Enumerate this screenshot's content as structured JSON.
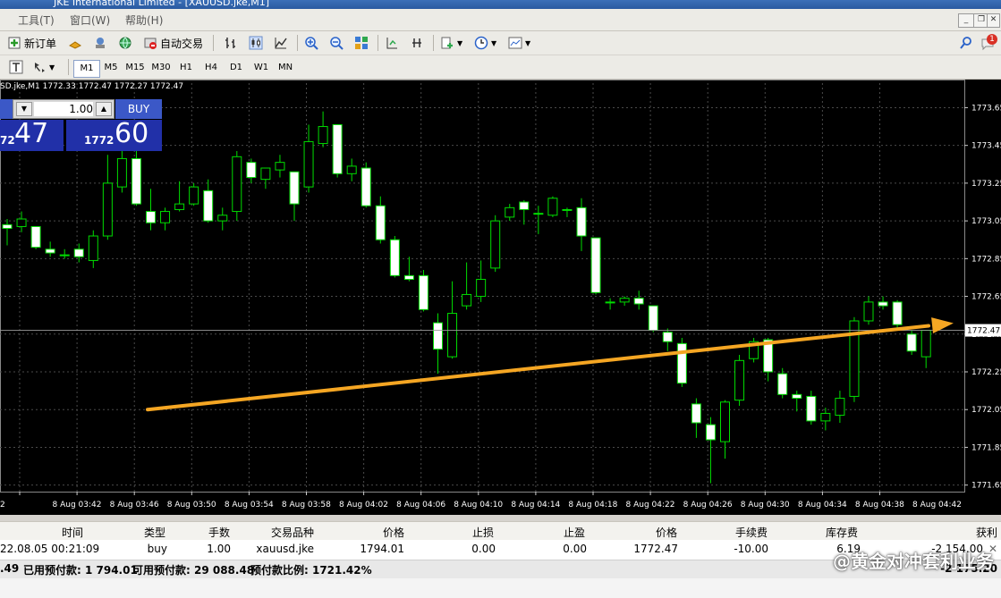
{
  "window": {
    "title_fragment": "JKE International Limited - [XAUUSD.jke,M1]",
    "menus": [
      "工具(T)",
      "窗口(W)",
      "帮助(H)"
    ]
  },
  "toolbar": {
    "new_order_label": "新订单",
    "auto_trade_label": "自动交易",
    "timeframes": [
      "M1",
      "M5",
      "M15",
      "M30",
      "H1",
      "H4",
      "D1",
      "W1",
      "MN"
    ],
    "active_timeframe": "M1",
    "notification_count": "1"
  },
  "chart": {
    "ohlc_label": "SD.jke,M1  1772.33  1772.47  1772.27  1772.47",
    "current_price_label": "1772.47",
    "price_ticks": [
      "1773.65",
      "1773.45",
      "1773.25",
      "1773.05",
      "1772.85",
      "1772.65",
      "1772.45",
      "1772.25",
      "1772.05",
      "1771.85",
      "1771.65"
    ],
    "time_ticks": [
      "8 Aug 03:42",
      "8 Aug 03:46",
      "8 Aug 03:50",
      "8 Aug 03:54",
      "8 Aug 03:58",
      "8 Aug 04:02",
      "8 Aug 04:06",
      "8 Aug 04:10",
      "8 Aug 04:14",
      "8 Aug 04:18",
      "8 Aug 04:22",
      "8 Aug 04:26",
      "8 Aug 04:30",
      "8 Aug 04:34",
      "8 Aug 04:38",
      "8 Aug 04:42"
    ],
    "first_time_tick_fragment": "2",
    "colors": {
      "background": "#000000",
      "candle": "#00dd00",
      "bull_body": "#000000",
      "bear_body": "#ffffff",
      "arrow": "#f5a623",
      "grid": "#4a4a4a"
    },
    "one_click": {
      "lot_value": "1.00",
      "buy_label": "BUY",
      "sell_price_small": "72",
      "sell_price_big": "47",
      "buy_price_small": "1772",
      "buy_price_big": "60"
    }
  },
  "chart_data": {
    "type": "candlestick",
    "y_range": [
      1771.62,
      1773.78
    ],
    "candles": [
      {
        "o": 1773.03,
        "h": 1773.06,
        "l": 1772.92,
        "c": 1773.01
      },
      {
        "o": 1773.02,
        "h": 1773.1,
        "l": 1772.99,
        "c": 1773.06
      },
      {
        "o": 1773.02,
        "h": 1773.02,
        "l": 1772.9,
        "c": 1772.91
      },
      {
        "o": 1772.9,
        "h": 1772.94,
        "l": 1772.86,
        "c": 1772.88
      },
      {
        "o": 1772.87,
        "h": 1772.9,
        "l": 1772.85,
        "c": 1772.87
      },
      {
        "o": 1772.9,
        "h": 1772.93,
        "l": 1772.83,
        "c": 1772.86
      },
      {
        "o": 1772.84,
        "h": 1773.0,
        "l": 1772.8,
        "c": 1772.97
      },
      {
        "o": 1772.97,
        "h": 1773.4,
        "l": 1772.95,
        "c": 1773.25
      },
      {
        "o": 1773.23,
        "h": 1773.42,
        "l": 1773.2,
        "c": 1773.38
      },
      {
        "o": 1773.38,
        "h": 1773.43,
        "l": 1773.13,
        "c": 1773.14
      },
      {
        "o": 1773.1,
        "h": 1773.22,
        "l": 1773.0,
        "c": 1773.04
      },
      {
        "o": 1773.04,
        "h": 1773.12,
        "l": 1773.0,
        "c": 1773.1
      },
      {
        "o": 1773.11,
        "h": 1773.26,
        "l": 1773.1,
        "c": 1773.14
      },
      {
        "o": 1773.14,
        "h": 1773.25,
        "l": 1773.13,
        "c": 1773.23
      },
      {
        "o": 1773.21,
        "h": 1773.27,
        "l": 1773.04,
        "c": 1773.05
      },
      {
        "o": 1773.05,
        "h": 1773.12,
        "l": 1773.0,
        "c": 1773.08
      },
      {
        "o": 1773.1,
        "h": 1773.42,
        "l": 1773.05,
        "c": 1773.39
      },
      {
        "o": 1773.36,
        "h": 1773.38,
        "l": 1773.25,
        "c": 1773.28
      },
      {
        "o": 1773.27,
        "h": 1773.33,
        "l": 1773.22,
        "c": 1773.33
      },
      {
        "o": 1773.32,
        "h": 1773.4,
        "l": 1773.28,
        "c": 1773.36
      },
      {
        "o": 1773.31,
        "h": 1773.31,
        "l": 1773.05,
        "c": 1773.14
      },
      {
        "o": 1773.23,
        "h": 1773.56,
        "l": 1773.2,
        "c": 1773.47
      },
      {
        "o": 1773.46,
        "h": 1773.63,
        "l": 1773.44,
        "c": 1773.55
      },
      {
        "o": 1773.56,
        "h": 1773.56,
        "l": 1773.28,
        "c": 1773.3
      },
      {
        "o": 1773.3,
        "h": 1773.38,
        "l": 1773.26,
        "c": 1773.34
      },
      {
        "o": 1773.33,
        "h": 1773.36,
        "l": 1773.12,
        "c": 1773.13
      },
      {
        "o": 1773.13,
        "h": 1773.18,
        "l": 1772.93,
        "c": 1772.95
      },
      {
        "o": 1772.95,
        "h": 1772.97,
        "l": 1772.75,
        "c": 1772.76
      },
      {
        "o": 1772.76,
        "h": 1772.86,
        "l": 1772.73,
        "c": 1772.74
      },
      {
        "o": 1772.76,
        "h": 1772.79,
        "l": 1772.57,
        "c": 1772.58
      },
      {
        "o": 1772.51,
        "h": 1772.56,
        "l": 1772.24,
        "c": 1772.37
      },
      {
        "o": 1772.33,
        "h": 1772.73,
        "l": 1772.32,
        "c": 1772.56
      },
      {
        "o": 1772.6,
        "h": 1772.83,
        "l": 1772.58,
        "c": 1772.66
      },
      {
        "o": 1772.65,
        "h": 1772.84,
        "l": 1772.62,
        "c": 1772.74
      },
      {
        "o": 1772.8,
        "h": 1773.08,
        "l": 1772.78,
        "c": 1773.05
      },
      {
        "o": 1773.07,
        "h": 1773.14,
        "l": 1773.05,
        "c": 1773.12
      },
      {
        "o": 1773.15,
        "h": 1773.16,
        "l": 1773.03,
        "c": 1773.11
      },
      {
        "o": 1773.09,
        "h": 1773.13,
        "l": 1772.98,
        "c": 1773.09
      },
      {
        "o": 1773.08,
        "h": 1773.18,
        "l": 1773.07,
        "c": 1773.17
      },
      {
        "o": 1773.11,
        "h": 1773.12,
        "l": 1773.07,
        "c": 1773.11
      },
      {
        "o": 1773.12,
        "h": 1773.17,
        "l": 1772.89,
        "c": 1772.97
      },
      {
        "o": 1772.96,
        "h": 1772.96,
        "l": 1772.66,
        "c": 1772.67
      },
      {
        "o": 1772.62,
        "h": 1772.64,
        "l": 1772.58,
        "c": 1772.62
      },
      {
        "o": 1772.62,
        "h": 1772.65,
        "l": 1772.6,
        "c": 1772.64
      },
      {
        "o": 1772.64,
        "h": 1772.68,
        "l": 1772.58,
        "c": 1772.61
      },
      {
        "o": 1772.6,
        "h": 1772.6,
        "l": 1772.46,
        "c": 1772.47
      },
      {
        "o": 1772.46,
        "h": 1772.48,
        "l": 1772.36,
        "c": 1772.41
      },
      {
        "o": 1772.4,
        "h": 1772.43,
        "l": 1772.17,
        "c": 1772.19
      },
      {
        "o": 1772.08,
        "h": 1772.11,
        "l": 1771.9,
        "c": 1771.98
      },
      {
        "o": 1771.97,
        "h": 1772.01,
        "l": 1771.66,
        "c": 1771.89
      },
      {
        "o": 1771.88,
        "h": 1772.1,
        "l": 1771.79,
        "c": 1772.09
      },
      {
        "o": 1772.1,
        "h": 1772.34,
        "l": 1772.07,
        "c": 1772.31
      },
      {
        "o": 1772.32,
        "h": 1772.43,
        "l": 1772.3,
        "c": 1772.41
      },
      {
        "o": 1772.42,
        "h": 1772.43,
        "l": 1772.2,
        "c": 1772.25
      },
      {
        "o": 1772.24,
        "h": 1772.27,
        "l": 1772.11,
        "c": 1772.13
      },
      {
        "o": 1772.13,
        "h": 1772.15,
        "l": 1772.04,
        "c": 1772.11
      },
      {
        "o": 1772.12,
        "h": 1772.15,
        "l": 1771.97,
        "c": 1771.99
      },
      {
        "o": 1771.99,
        "h": 1772.06,
        "l": 1771.94,
        "c": 1772.03
      },
      {
        "o": 1772.02,
        "h": 1772.15,
        "l": 1771.98,
        "c": 1772.11
      },
      {
        "o": 1772.12,
        "h": 1772.54,
        "l": 1772.09,
        "c": 1772.52
      },
      {
        "o": 1772.52,
        "h": 1772.65,
        "l": 1772.5,
        "c": 1772.62
      },
      {
        "o": 1772.62,
        "h": 1772.65,
        "l": 1772.58,
        "c": 1772.6
      },
      {
        "o": 1772.62,
        "h": 1772.63,
        "l": 1772.48,
        "c": 1772.5
      },
      {
        "o": 1772.45,
        "h": 1772.47,
        "l": 1772.34,
        "c": 1772.36
      },
      {
        "o": 1772.33,
        "h": 1772.47,
        "l": 1772.27,
        "c": 1772.47
      }
    ],
    "trend_arrow": {
      "from_price": 1772.05,
      "to_price": 1772.5
    }
  },
  "positions": {
    "headers": [
      "时间",
      "类型",
      "手数",
      "交易品种",
      "价格",
      "止损",
      "止盈",
      "价格",
      "手续费",
      "库存费",
      "获利"
    ],
    "row": [
      "22.08.05 00:21:09",
      "buy",
      "1.00",
      "xauusd.jke",
      "1794.01",
      "0.00",
      "0.00",
      "1772.47",
      "-10.00",
      "6.19",
      "-2 154.00"
    ],
    "balance_prefix": ".49",
    "used_margin": "已用预付款: 1 794.01",
    "free_margin": "可用预付款: 29 088.48",
    "margin_level": "预付款比例: 1721.42%",
    "total_profit_fragment": "-2 175.20"
  },
  "watermark": "@黄金对冲套利业务"
}
